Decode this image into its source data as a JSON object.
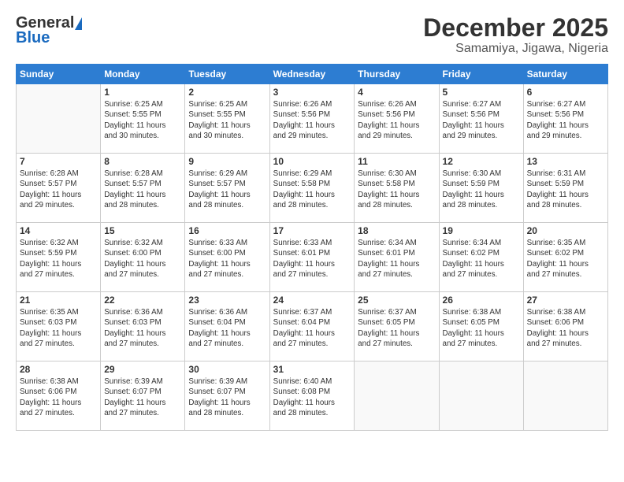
{
  "logo": {
    "general": "General",
    "blue": "Blue"
  },
  "title": "December 2025",
  "subtitle": "Samamiya, Jigawa, Nigeria",
  "days": [
    "Sunday",
    "Monday",
    "Tuesday",
    "Wednesday",
    "Thursday",
    "Friday",
    "Saturday"
  ],
  "weeks": [
    [
      {
        "date": "",
        "info": ""
      },
      {
        "date": "1",
        "info": "Sunrise: 6:25 AM\nSunset: 5:55 PM\nDaylight: 11 hours\nand 30 minutes."
      },
      {
        "date": "2",
        "info": "Sunrise: 6:25 AM\nSunset: 5:55 PM\nDaylight: 11 hours\nand 30 minutes."
      },
      {
        "date": "3",
        "info": "Sunrise: 6:26 AM\nSunset: 5:56 PM\nDaylight: 11 hours\nand 29 minutes."
      },
      {
        "date": "4",
        "info": "Sunrise: 6:26 AM\nSunset: 5:56 PM\nDaylight: 11 hours\nand 29 minutes."
      },
      {
        "date": "5",
        "info": "Sunrise: 6:27 AM\nSunset: 5:56 PM\nDaylight: 11 hours\nand 29 minutes."
      },
      {
        "date": "6",
        "info": "Sunrise: 6:27 AM\nSunset: 5:56 PM\nDaylight: 11 hours\nand 29 minutes."
      }
    ],
    [
      {
        "date": "7",
        "info": "Sunrise: 6:28 AM\nSunset: 5:57 PM\nDaylight: 11 hours\nand 29 minutes."
      },
      {
        "date": "8",
        "info": "Sunrise: 6:28 AM\nSunset: 5:57 PM\nDaylight: 11 hours\nand 28 minutes."
      },
      {
        "date": "9",
        "info": "Sunrise: 6:29 AM\nSunset: 5:57 PM\nDaylight: 11 hours\nand 28 minutes."
      },
      {
        "date": "10",
        "info": "Sunrise: 6:29 AM\nSunset: 5:58 PM\nDaylight: 11 hours\nand 28 minutes."
      },
      {
        "date": "11",
        "info": "Sunrise: 6:30 AM\nSunset: 5:58 PM\nDaylight: 11 hours\nand 28 minutes."
      },
      {
        "date": "12",
        "info": "Sunrise: 6:30 AM\nSunset: 5:59 PM\nDaylight: 11 hours\nand 28 minutes."
      },
      {
        "date": "13",
        "info": "Sunrise: 6:31 AM\nSunset: 5:59 PM\nDaylight: 11 hours\nand 28 minutes."
      }
    ],
    [
      {
        "date": "14",
        "info": "Sunrise: 6:32 AM\nSunset: 5:59 PM\nDaylight: 11 hours\nand 27 minutes."
      },
      {
        "date": "15",
        "info": "Sunrise: 6:32 AM\nSunset: 6:00 PM\nDaylight: 11 hours\nand 27 minutes."
      },
      {
        "date": "16",
        "info": "Sunrise: 6:33 AM\nSunset: 6:00 PM\nDaylight: 11 hours\nand 27 minutes."
      },
      {
        "date": "17",
        "info": "Sunrise: 6:33 AM\nSunset: 6:01 PM\nDaylight: 11 hours\nand 27 minutes."
      },
      {
        "date": "18",
        "info": "Sunrise: 6:34 AM\nSunset: 6:01 PM\nDaylight: 11 hours\nand 27 minutes."
      },
      {
        "date": "19",
        "info": "Sunrise: 6:34 AM\nSunset: 6:02 PM\nDaylight: 11 hours\nand 27 minutes."
      },
      {
        "date": "20",
        "info": "Sunrise: 6:35 AM\nSunset: 6:02 PM\nDaylight: 11 hours\nand 27 minutes."
      }
    ],
    [
      {
        "date": "21",
        "info": "Sunrise: 6:35 AM\nSunset: 6:03 PM\nDaylight: 11 hours\nand 27 minutes."
      },
      {
        "date": "22",
        "info": "Sunrise: 6:36 AM\nSunset: 6:03 PM\nDaylight: 11 hours\nand 27 minutes."
      },
      {
        "date": "23",
        "info": "Sunrise: 6:36 AM\nSunset: 6:04 PM\nDaylight: 11 hours\nand 27 minutes."
      },
      {
        "date": "24",
        "info": "Sunrise: 6:37 AM\nSunset: 6:04 PM\nDaylight: 11 hours\nand 27 minutes."
      },
      {
        "date": "25",
        "info": "Sunrise: 6:37 AM\nSunset: 6:05 PM\nDaylight: 11 hours\nand 27 minutes."
      },
      {
        "date": "26",
        "info": "Sunrise: 6:38 AM\nSunset: 6:05 PM\nDaylight: 11 hours\nand 27 minutes."
      },
      {
        "date": "27",
        "info": "Sunrise: 6:38 AM\nSunset: 6:06 PM\nDaylight: 11 hours\nand 27 minutes."
      }
    ],
    [
      {
        "date": "28",
        "info": "Sunrise: 6:38 AM\nSunset: 6:06 PM\nDaylight: 11 hours\nand 27 minutes."
      },
      {
        "date": "29",
        "info": "Sunrise: 6:39 AM\nSunset: 6:07 PM\nDaylight: 11 hours\nand 27 minutes."
      },
      {
        "date": "30",
        "info": "Sunrise: 6:39 AM\nSunset: 6:07 PM\nDaylight: 11 hours\nand 28 minutes."
      },
      {
        "date": "31",
        "info": "Sunrise: 6:40 AM\nSunset: 6:08 PM\nDaylight: 11 hours\nand 28 minutes."
      },
      {
        "date": "",
        "info": ""
      },
      {
        "date": "",
        "info": ""
      },
      {
        "date": "",
        "info": ""
      }
    ]
  ]
}
